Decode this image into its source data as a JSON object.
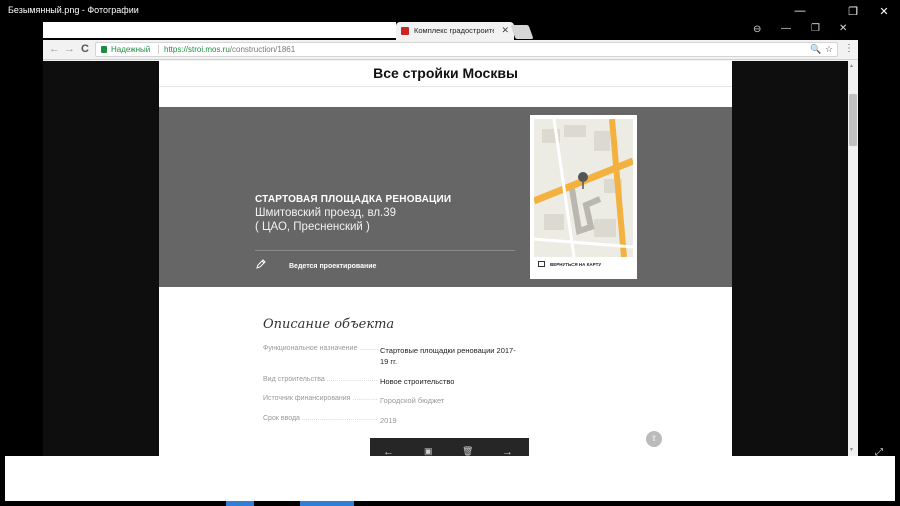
{
  "photos": {
    "title": "Безымянный.png - Фотографии",
    "controls": {
      "minimize": "—",
      "maximize": "❐",
      "close": "✕"
    }
  },
  "browser": {
    "tab": {
      "title": "Комплекс градостроите",
      "close": "✕",
      "favicon_color": "#c62828"
    },
    "controls": {
      "profile": "⊖",
      "minimize": "—",
      "maximize": "❐",
      "close": "✕"
    },
    "nav": {
      "back": "←",
      "forward": "→",
      "reload": "C"
    },
    "omnibox": {
      "secure_label": "Надежный",
      "url_host": "https://stroi.mos.ru",
      "url_path": "/construction/1861",
      "zoom_icon": "🔍",
      "star_icon": "☆"
    },
    "menu": "⋮"
  },
  "page": {
    "site_title": "Все стройки Москвы",
    "hero": {
      "kicker": "СТАРТОВАЯ ПЛОЩАДКА РЕНОВАЦИИ",
      "address": "Шмитовский проезд, вл.39",
      "district": "( ЦАО, Пресненский )",
      "status": "Ведется проектирование",
      "map_link": "ВЕРНУТЬСЯ НА КАРТУ",
      "bg_color": "#666666"
    },
    "description": {
      "title": "Описание объекта",
      "rows": [
        {
          "label": "Функциональное назначение",
          "value": "Стартовые площадки реновации 2017-19 гг."
        },
        {
          "label": "Вид строительства",
          "value": "Новое строительство"
        },
        {
          "label": "Источник финансирования",
          "value": "Городской бюджет"
        },
        {
          "label": "Срок ввода",
          "value": "2019"
        }
      ]
    },
    "scroll_top": "⇧"
  },
  "viewer": {
    "prev": "←",
    "gallery": "▣",
    "delete": "🗑",
    "next": "→",
    "fullscreen": "⤢"
  },
  "colors": {
    "accent_blue": "#2f7fd8",
    "secure_green": "#1e8e3e"
  }
}
